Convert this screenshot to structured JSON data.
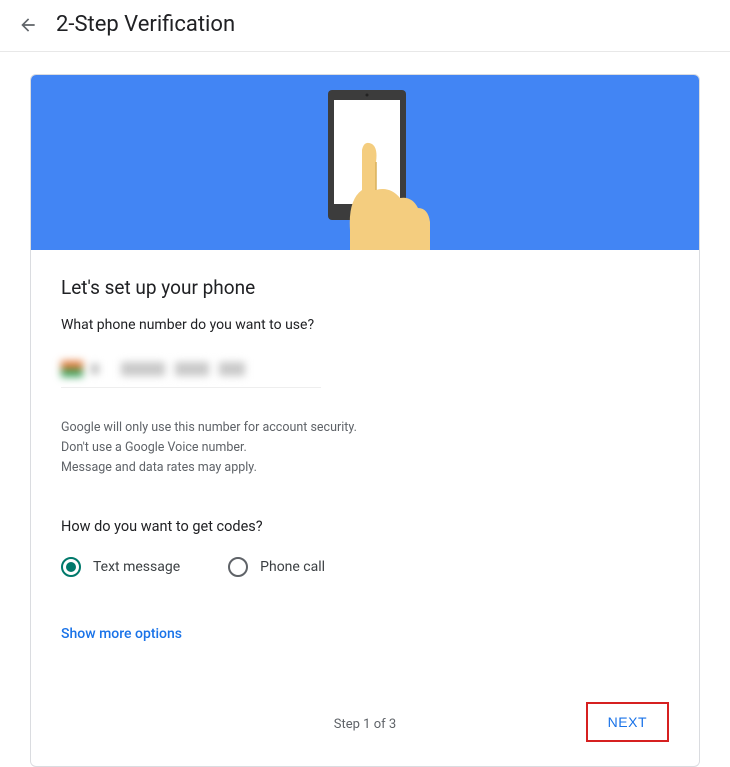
{
  "header": {
    "title": "2-Step Verification"
  },
  "card": {
    "heading": "Let's set up your phone",
    "question": "What phone number do you want to use?",
    "disclaimer_line1": "Google will only use this number for account security.",
    "disclaimer_line2": "Don't use a Google Voice number.",
    "disclaimer_line3": "Message and data rates may apply.",
    "codes_heading": "How do you want to get codes?",
    "radios": {
      "text_message": "Text message",
      "phone_call": "Phone call"
    },
    "show_more": "Show more options",
    "step_text": "Step 1 of 3",
    "next_label": "NEXT"
  }
}
